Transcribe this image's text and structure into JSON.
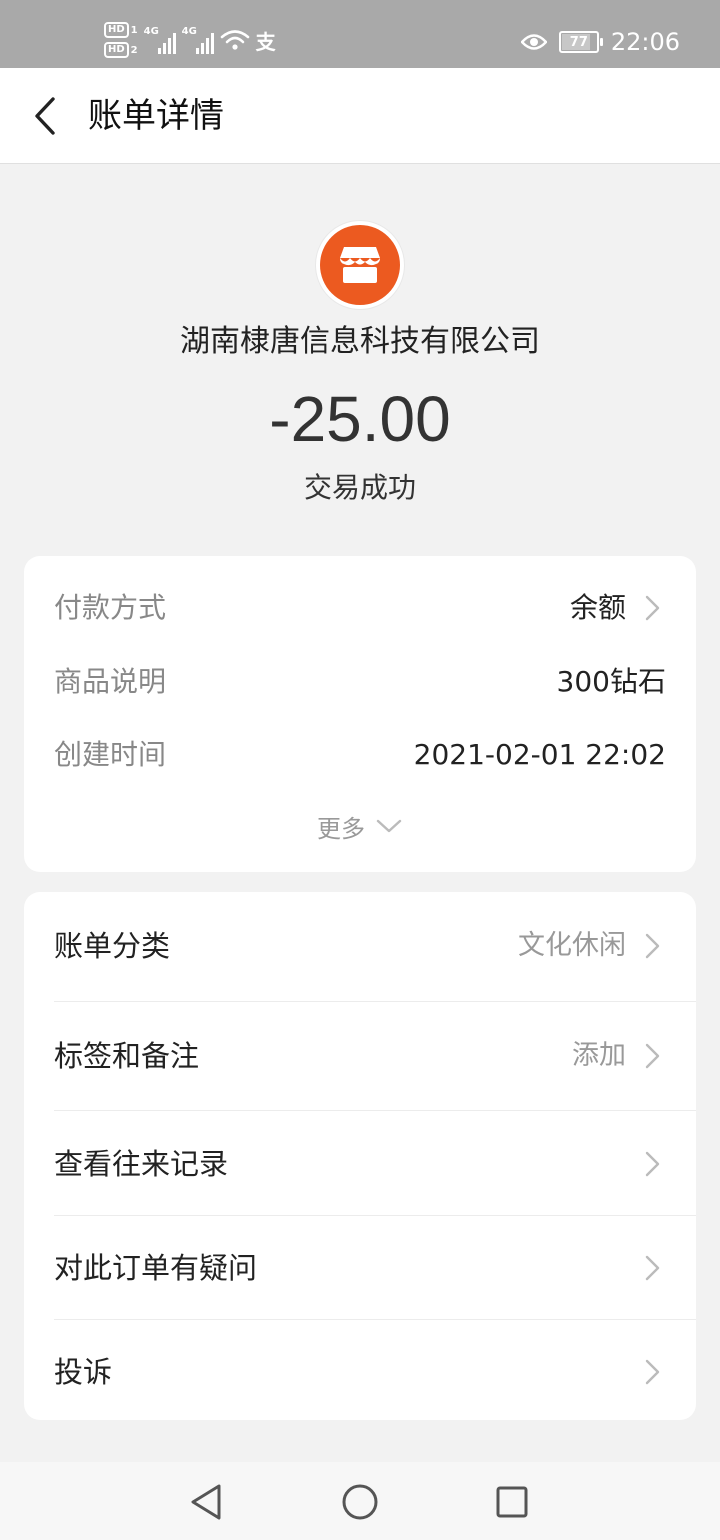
{
  "status_bar": {
    "sim1": "HD",
    "sim1_slot": "1",
    "sim2": "HD",
    "sim2_slot": "2",
    "net1": "4G",
    "net2": "4G",
    "app_icon": "支",
    "battery": "77",
    "time": "22:06"
  },
  "header": {
    "title": "账单详情"
  },
  "hero": {
    "merchant": "湖南棣唐信息科技有限公司",
    "amount": "-25.00",
    "status": "交易成功",
    "logo_color": "#ec5a20"
  },
  "details": [
    {
      "key": "付款方式",
      "value": "余额"
    },
    {
      "key": "商品说明",
      "value": "300钻石"
    },
    {
      "key": "创建时间",
      "value": "2021-02-01 22:02"
    }
  ],
  "more_label": "更多",
  "actions": [
    {
      "label": "账单分类",
      "value": "文化休闲"
    },
    {
      "label": "标签和备注",
      "value": "添加"
    },
    {
      "label": "查看往来记录",
      "value": ""
    },
    {
      "label": "对此订单有疑问",
      "value": ""
    },
    {
      "label": "投诉",
      "value": ""
    }
  ]
}
